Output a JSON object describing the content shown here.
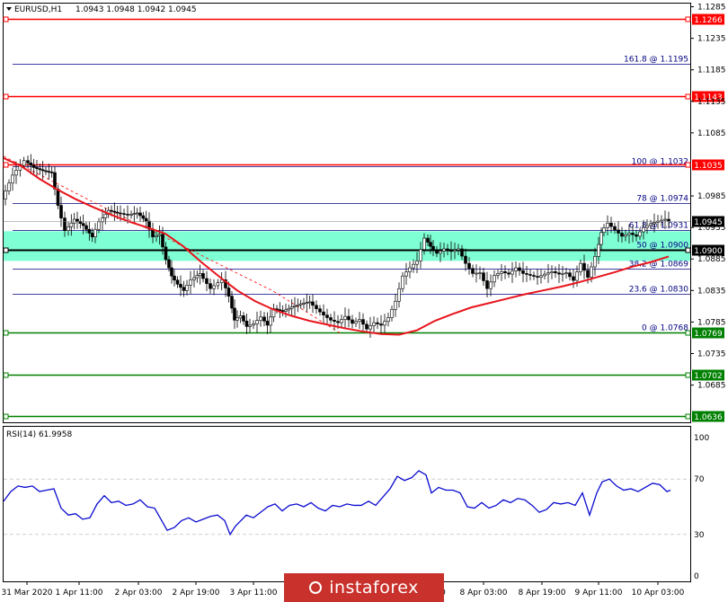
{
  "header": {
    "symbol_tf": "EURUSD,H1",
    "ohlc": "1.0943 1.0948 1.0942 1.0945"
  },
  "rsi_panel": {
    "title": "RSI(14) 61.9958",
    "ticks": [
      "100",
      "70",
      "30",
      "0"
    ]
  },
  "watermark": {
    "text": "instaforex"
  },
  "colors": {
    "resistance": "#ff0000",
    "support": "#008000",
    "fibo": "#000080",
    "ma": "#e8141c",
    "zone": "#7fffd4",
    "rsi": "#0a0ad0",
    "price_label": "#000000"
  },
  "chart_data": [
    {
      "type": "candlestick",
      "title": "",
      "ylim": [
        1.0626,
        1.129
      ],
      "price_axis_ticks": [
        "1.1285",
        "1.1235",
        "1.1185",
        "1.1135",
        "1.1085",
        "1.0985",
        "1.0935",
        "1.0885",
        "1.0835",
        "1.0785",
        "1.0735",
        "1.0685"
      ],
      "time_axis_ticks": [
        "31 Mar 2020",
        "1 Apr 11:00",
        "2 Apr 03:00",
        "2 Apr 19:00",
        "3 Apr 11:00",
        "0",
        "8 Apr 03:00",
        "8 Apr 19:00",
        "9 Apr 11:00",
        "10 Apr 03:00"
      ],
      "horizontal_levels": [
        {
          "label": "1.1266",
          "value": 1.1266,
          "kind": "resistance"
        },
        {
          "label": "1.1143",
          "value": 1.1143,
          "kind": "resistance"
        },
        {
          "label": "1.1035",
          "value": 1.1035,
          "kind": "resistance"
        },
        {
          "label": "1.0900",
          "value": 1.09,
          "kind": "pivot"
        },
        {
          "label": "1.0769",
          "value": 1.0769,
          "kind": "support"
        },
        {
          "label": "1.0702",
          "value": 1.0702,
          "kind": "support"
        },
        {
          "label": "1.0636",
          "value": 1.0636,
          "kind": "support"
        }
      ],
      "fibonacci": [
        {
          "label": "161.8 @ 1.1195",
          "value": 1.1195
        },
        {
          "label": "100 @ 1.1032",
          "value": 1.1032
        },
        {
          "label": "78 @ 1.0974",
          "value": 1.0974
        },
        {
          "label": "61.8 @ 1.0931",
          "value": 1.0931
        },
        {
          "label": "50 @ 1.0900",
          "value": 1.09
        },
        {
          "label": "38.2 @ 1.0869",
          "value": 1.0869
        },
        {
          "label": "23.6 @ 1.0830",
          "value": 1.083
        },
        {
          "label": "0 @ 1.0768",
          "value": 1.0768
        }
      ],
      "current_price": {
        "label": "1.0945",
        "value": 1.0945
      },
      "zone": [
        1.0882,
        1.0929
      ],
      "moving_average_path": [
        [
          0,
          1.1045
        ],
        [
          20,
          1.1032
        ],
        [
          40,
          1.1012
        ],
        [
          60,
          1.0995
        ],
        [
          80,
          1.098
        ],
        [
          100,
          1.0967
        ],
        [
          120,
          1.0955
        ],
        [
          140,
          1.0944
        ],
        [
          160,
          1.0935
        ],
        [
          180,
          1.0925
        ],
        [
          200,
          1.0905
        ],
        [
          220,
          1.088
        ],
        [
          240,
          1.0857
        ],
        [
          260,
          1.0835
        ],
        [
          280,
          1.0818
        ],
        [
          300,
          1.0805
        ],
        [
          320,
          1.0795
        ],
        [
          340,
          1.0787
        ],
        [
          360,
          1.0781
        ],
        [
          380,
          1.0775
        ],
        [
          400,
          1.077
        ],
        [
          420,
          1.0766
        ],
        [
          440,
          1.0765
        ],
        [
          460,
          1.0772
        ],
        [
          480,
          1.0787
        ],
        [
          500,
          1.0798
        ],
        [
          520,
          1.0808
        ],
        [
          540,
          1.0815
        ],
        [
          560,
          1.0822
        ],
        [
          580,
          1.0829
        ],
        [
          600,
          1.0835
        ],
        [
          620,
          1.0841
        ],
        [
          640,
          1.0848
        ],
        [
          660,
          1.0856
        ],
        [
          680,
          1.0864
        ],
        [
          700,
          1.0873
        ],
        [
          720,
          1.088
        ],
        [
          740,
          1.0889
        ]
      ],
      "trend_line": [
        [
          0,
          1.1048
        ],
        [
          100,
          1.0975
        ],
        [
          200,
          1.0905
        ],
        [
          300,
          1.0834
        ],
        [
          375,
          1.0767
        ]
      ],
      "price_path": [
        [
          0,
          1.098
        ],
        [
          12,
          1.1018
        ],
        [
          25,
          1.1041
        ],
        [
          35,
          1.103
        ],
        [
          45,
          1.1025
        ],
        [
          55,
          1.1022
        ],
        [
          62,
          1.097
        ],
        [
          70,
          1.093
        ],
        [
          80,
          1.0948
        ],
        [
          90,
          1.0938
        ],
        [
          100,
          1.092
        ],
        [
          108,
          1.0944
        ],
        [
          118,
          1.0962
        ],
        [
          128,
          1.0958
        ],
        [
          140,
          1.0955
        ],
        [
          150,
          1.0958
        ],
        [
          160,
          1.0945
        ],
        [
          168,
          1.092
        ],
        [
          175,
          1.0924
        ],
        [
          182,
          1.0884
        ],
        [
          188,
          1.0858
        ],
        [
          195,
          1.0845
        ],
        [
          202,
          1.0835
        ],
        [
          210,
          1.0852
        ],
        [
          220,
          1.0862
        ],
        [
          232,
          1.0838
        ],
        [
          245,
          1.0852
        ],
        [
          252,
          1.0826
        ],
        [
          258,
          1.0788
        ],
        [
          265,
          1.0795
        ],
        [
          272,
          1.0778
        ],
        [
          280,
          1.0782
        ],
        [
          288,
          1.0793
        ],
        [
          295,
          1.078
        ],
        [
          302,
          1.0806
        ],
        [
          312,
          1.0802
        ],
        [
          322,
          1.0809
        ],
        [
          332,
          1.0814
        ],
        [
          342,
          1.0817
        ],
        [
          350,
          1.0806
        ],
        [
          358,
          1.0796
        ],
        [
          366,
          1.0788
        ],
        [
          374,
          1.0784
        ],
        [
          382,
          1.0794
        ],
        [
          390,
          1.0783
        ],
        [
          398,
          1.0789
        ],
        [
          406,
          1.0774
        ],
        [
          414,
          1.0784
        ],
        [
          422,
          1.078
        ],
        [
          430,
          1.0792
        ],
        [
          438,
          1.0818
        ],
        [
          446,
          1.0858
        ],
        [
          454,
          1.0871
        ],
        [
          462,
          1.0882
        ],
        [
          470,
          1.0918
        ],
        [
          476,
          1.0905
        ],
        [
          484,
          1.0894
        ],
        [
          492,
          1.0901
        ],
        [
          500,
          1.0897
        ],
        [
          508,
          1.0901
        ],
        [
          516,
          1.0878
        ],
        [
          524,
          1.0862
        ],
        [
          532,
          1.0863
        ],
        [
          540,
          1.0838
        ],
        [
          548,
          1.0859
        ],
        [
          556,
          1.0865
        ],
        [
          564,
          1.0861
        ],
        [
          572,
          1.0871
        ],
        [
          580,
          1.0862
        ],
        [
          588,
          1.0859
        ],
        [
          596,
          1.0856
        ],
        [
          604,
          1.0861
        ],
        [
          612,
          1.0865
        ],
        [
          620,
          1.0861
        ],
        [
          628,
          1.0863
        ],
        [
          636,
          1.0851
        ],
        [
          644,
          1.0878
        ],
        [
          652,
          1.0856
        ],
        [
          660,
          1.0889
        ],
        [
          666,
          1.0927
        ],
        [
          674,
          1.0942
        ],
        [
          682,
          1.0931
        ],
        [
          690,
          1.0921
        ],
        [
          698,
          1.0926
        ],
        [
          706,
          1.0921
        ],
        [
          714,
          1.0935
        ],
        [
          722,
          1.0941
        ],
        [
          730,
          1.0945
        ],
        [
          738,
          1.0948
        ],
        [
          742,
          1.0945
        ]
      ]
    },
    {
      "type": "line",
      "title": "",
      "ylim": [
        0,
        100
      ],
      "series": [
        {
          "values": [
            [
              0,
              54
            ],
            [
              8,
              61
            ],
            [
              16,
              65
            ],
            [
              24,
              64
            ],
            [
              32,
              65
            ],
            [
              40,
              61
            ],
            [
              48,
              62
            ],
            [
              56,
              63
            ],
            [
              64,
              49
            ],
            [
              72,
              44
            ],
            [
              80,
              45
            ],
            [
              88,
              41
            ],
            [
              96,
              42
            ],
            [
              104,
              52
            ],
            [
              112,
              58
            ],
            [
              120,
              53
            ],
            [
              128,
              54
            ],
            [
              136,
              51
            ],
            [
              144,
              52
            ],
            [
              152,
              55
            ],
            [
              160,
              50
            ],
            [
              168,
              49
            ],
            [
              175,
              41
            ],
            [
              182,
              33
            ],
            [
              190,
              35
            ],
            [
              198,
              40
            ],
            [
              206,
              42
            ],
            [
              214,
              39
            ],
            [
              222,
              41
            ],
            [
              230,
              43
            ],
            [
              238,
              44
            ],
            [
              246,
              40
            ],
            [
              252,
              30
            ],
            [
              258,
              36
            ],
            [
              264,
              40
            ],
            [
              270,
              44
            ],
            [
              278,
              42
            ],
            [
              286,
              46
            ],
            [
              294,
              50
            ],
            [
              302,
              52
            ],
            [
              310,
              47
            ],
            [
              318,
              51
            ],
            [
              326,
              52
            ],
            [
              334,
              50
            ],
            [
              342,
              53
            ],
            [
              350,
              49
            ],
            [
              358,
              47
            ],
            [
              366,
              51
            ],
            [
              374,
              50
            ],
            [
              382,
              52
            ],
            [
              390,
              51
            ],
            [
              398,
              51
            ],
            [
              406,
              54
            ],
            [
              414,
              51
            ],
            [
              422,
              57
            ],
            [
              430,
              63
            ],
            [
              438,
              72
            ],
            [
              446,
              69
            ],
            [
              454,
              71
            ],
            [
              462,
              76
            ],
            [
              470,
              73
            ],
            [
              476,
              60
            ],
            [
              484,
              64
            ],
            [
              492,
              62
            ],
            [
              500,
              62
            ],
            [
              508,
              60
            ],
            [
              516,
              50
            ],
            [
              524,
              49
            ],
            [
              532,
              53
            ],
            [
              540,
              49
            ],
            [
              548,
              51
            ],
            [
              556,
              55
            ],
            [
              564,
              53
            ],
            [
              572,
              56
            ],
            [
              580,
              55
            ],
            [
              588,
              51
            ],
            [
              596,
              46
            ],
            [
              604,
              48
            ],
            [
              612,
              53
            ],
            [
              620,
              52
            ],
            [
              628,
              53
            ],
            [
              636,
              51
            ],
            [
              644,
              60
            ],
            [
              652,
              44
            ],
            [
              660,
              60
            ],
            [
              666,
              68
            ],
            [
              674,
              70
            ],
            [
              682,
              65
            ],
            [
              690,
              62
            ],
            [
              698,
              63
            ],
            [
              706,
              61
            ],
            [
              714,
              64
            ],
            [
              722,
              67
            ],
            [
              730,
              66
            ],
            [
              738,
              61
            ],
            [
              742,
              62
            ]
          ]
        }
      ]
    }
  ]
}
